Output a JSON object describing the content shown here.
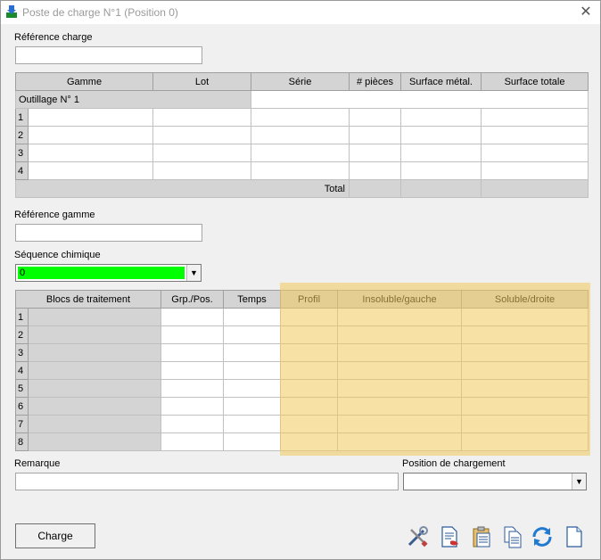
{
  "window": {
    "title": "Poste de charge N°1 (Position 0)"
  },
  "reference_charge": {
    "label": "Référence charge",
    "value": ""
  },
  "charge_table": {
    "columns": [
      "Gamme",
      "Lot",
      "Série",
      "# pièces",
      "Surface métal.",
      "Surface totale"
    ],
    "group_label": "Outillage N° 1",
    "rows": [
      "1",
      "2",
      "3",
      "4"
    ],
    "total_label": "Total"
  },
  "reference_gamme": {
    "label": "Référence gamme",
    "value": ""
  },
  "sequence": {
    "label": "Séquence chimique",
    "value": "0",
    "color": "#00ff00"
  },
  "treatment_table": {
    "columns": [
      "Blocs de traitement",
      "Grp./Pos.",
      "Temps",
      "Profil",
      "Insoluble/gauche",
      "Soluble/droite"
    ],
    "rows": [
      "1",
      "2",
      "3",
      "4",
      "5",
      "6",
      "7",
      "8"
    ],
    "highlight_color": "#f2c85a"
  },
  "remarque": {
    "label": "Remarque",
    "value": ""
  },
  "position_chargement": {
    "label": "Position de chargement",
    "value": ""
  },
  "buttons": {
    "charge": "Charge"
  },
  "toolbar_icons": [
    "tools-icon",
    "delete-document-icon",
    "paste-icon",
    "copy-icon",
    "refresh-icon",
    "new-document-icon"
  ]
}
